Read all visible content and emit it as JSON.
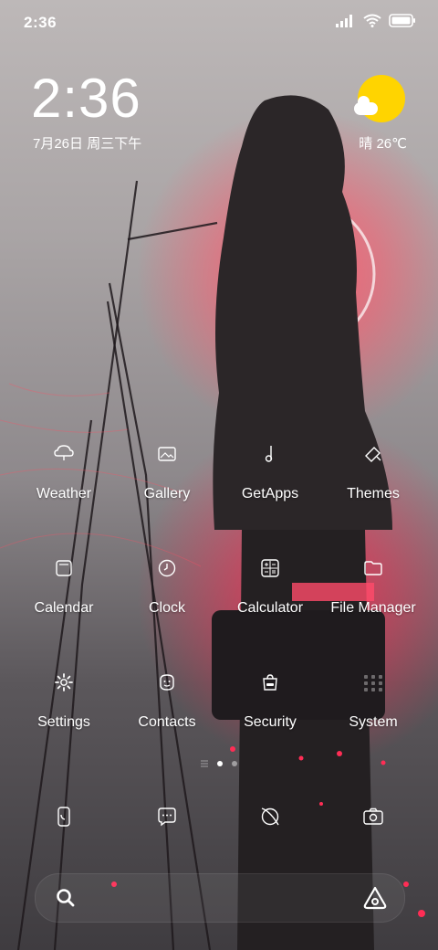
{
  "status_bar": {
    "time": "2:36",
    "icons": [
      "signal-icon",
      "wifi-icon",
      "battery-icon"
    ]
  },
  "clock_widget": {
    "time": "2:36",
    "date": "7月26日 周三下午"
  },
  "weather_widget": {
    "text": "晴 26℃",
    "icon": "sunny-partly-cloudy-icon",
    "sun_color": "#ffd400"
  },
  "apps": [
    {
      "label": "Weather",
      "icon": "weather-icon"
    },
    {
      "label": "Gallery",
      "icon": "gallery-icon"
    },
    {
      "label": "GetApps",
      "icon": "getapps-icon"
    },
    {
      "label": "Themes",
      "icon": "themes-icon"
    },
    {
      "label": "Calendar",
      "icon": "calendar-icon"
    },
    {
      "label": "Clock",
      "icon": "clock-icon"
    },
    {
      "label": "Calculator",
      "icon": "calculator-icon"
    },
    {
      "label": "File Manager",
      "icon": "folder-icon"
    },
    {
      "label": "Settings",
      "icon": "gear-icon"
    },
    {
      "label": "Contacts",
      "icon": "contacts-icon"
    },
    {
      "label": "Security",
      "icon": "shield-bag-icon"
    },
    {
      "label": "System",
      "icon": "folder-grid-icon"
    }
  ],
  "page_indicator": {
    "pages": 2,
    "active": 1
  },
  "dock": [
    {
      "icon": "phone-icon"
    },
    {
      "icon": "messages-icon"
    },
    {
      "icon": "browser-icon"
    },
    {
      "icon": "camera-icon"
    }
  ],
  "search_bar": {
    "left_icon": "search-icon",
    "right_icon": "assistant-icon"
  },
  "accent_colors": {
    "glow": "#ff3a55",
    "text": "#ffffff"
  }
}
